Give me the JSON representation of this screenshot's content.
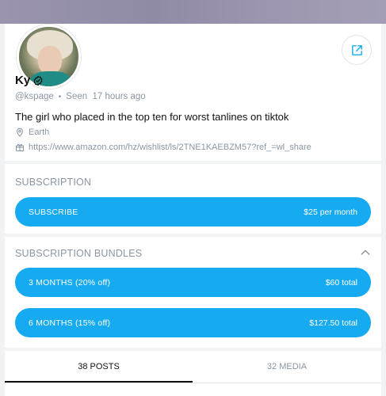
{
  "profile": {
    "name": "Ky",
    "handle": "@kspage",
    "last_seen": "Seen  17 hours ago",
    "bio": "The girl who placed in the top ten for worst tanlines on tiktok",
    "location": "Earth",
    "link": "https://www.amazon.com/hz/wishlist/ls/2TNE1KAEBZM57?ref_=wl_share"
  },
  "subscription": {
    "title": "SUBSCRIPTION",
    "button_label": "SUBSCRIBE",
    "price": "$25 per month"
  },
  "bundles": {
    "title": "SUBSCRIPTION BUNDLES",
    "items": [
      {
        "label": "3 MONTHS (20% off)",
        "price": "$60 total"
      },
      {
        "label": "6 MONTHS (15% off)",
        "price": "$127.50 total"
      }
    ]
  },
  "tabs": [
    {
      "label": "38 POSTS"
    },
    {
      "label": "32 MEDIA"
    }
  ],
  "colors": {
    "accent": "#16aaf0",
    "muted": "#8a96a3"
  },
  "icons": {
    "share": "share-icon",
    "verified": "verified-icon",
    "location": "location-pin-icon",
    "link": "gift-link-icon",
    "collapse": "chevron-up-icon"
  }
}
